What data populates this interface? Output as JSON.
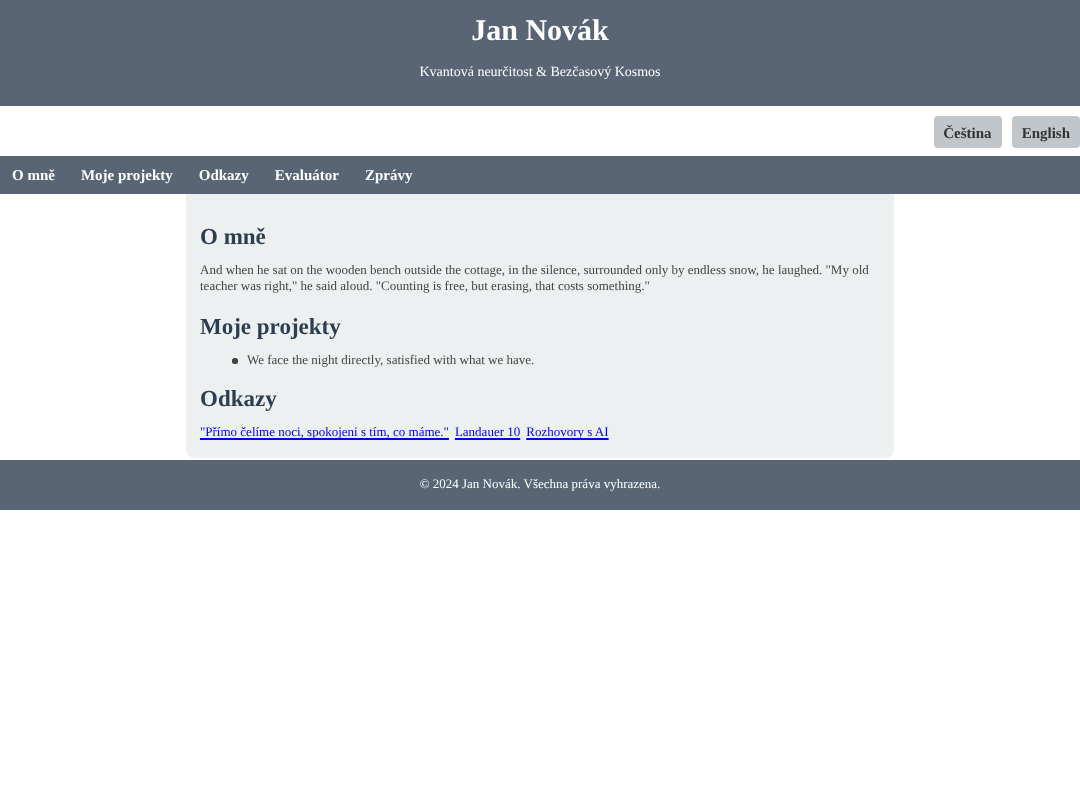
{
  "header": {
    "title": "Jan Novák",
    "subtitle": "Kvantová neurčitost & Bezčasový Kosmos"
  },
  "languages": [
    {
      "label": "Čeština"
    },
    {
      "label": "English"
    }
  ],
  "nav": [
    {
      "label": "O mně"
    },
    {
      "label": "Moje projekty"
    },
    {
      "label": "Odkazy"
    },
    {
      "label": "Evaluátor"
    },
    {
      "label": "Zprávy"
    }
  ],
  "sections": [
    {
      "heading": "O mně",
      "kind": "text",
      "text": "And when he sat on the wooden bench outside the cottage, in the silence, surrounded only by endless snow, he laughed. \"My old teacher was right,\" he said aloud. \"Counting is free, but erasing, that costs something.\""
    },
    {
      "heading": "Moje projekty",
      "kind": "list",
      "items": [
        "We face the night directly, satisfied with what we have."
      ]
    },
    {
      "heading": "Odkazy",
      "kind": "links",
      "links": [
        "\"Přímo čelíme noci, spokojeni s tím, co máme.\"",
        "Landauer 10",
        "Rozhovory s AI"
      ]
    }
  ],
  "footer": "© 2024 Jan Novák. Všechna práva vyhrazena."
}
